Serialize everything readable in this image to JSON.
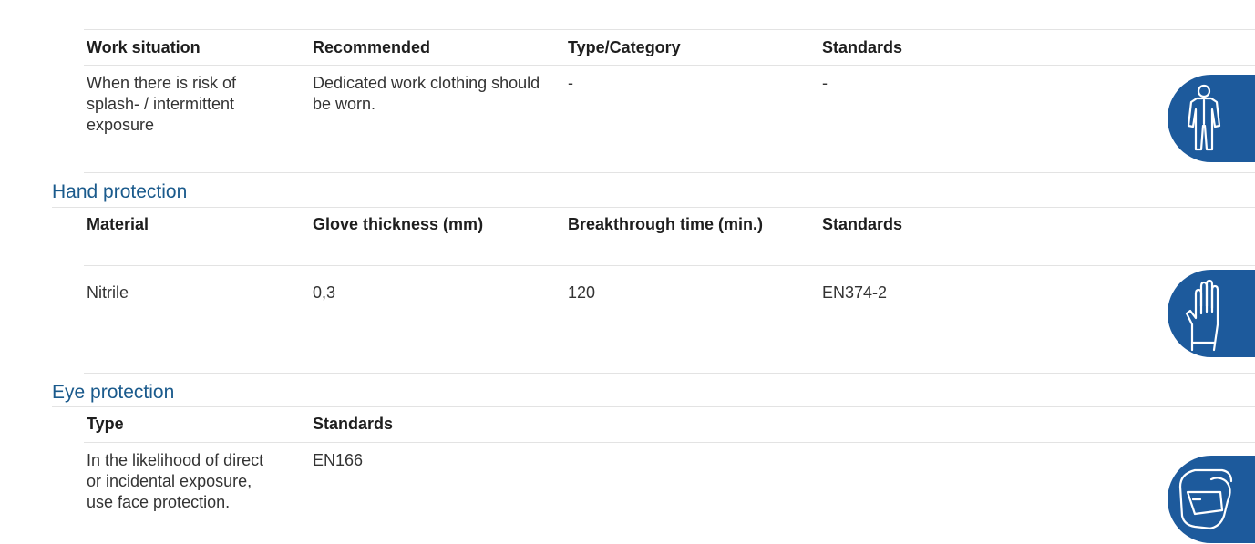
{
  "body_protection": {
    "headers": [
      "Work situation",
      "Recommended",
      "Type/Category",
      "Standards"
    ],
    "row": [
      "When there is risk of splash- / intermittent exposure",
      "Dedicated work clothing should be worn.",
      "-",
      "-"
    ],
    "icon": "protective-suit-icon"
  },
  "hand_protection": {
    "title": "Hand protection",
    "headers": [
      "Material",
      "Glove thickness (mm)",
      "Breakthrough time (min.)",
      "Standards"
    ],
    "row": [
      "Nitrile",
      "0,3",
      "120",
      "EN374-2"
    ],
    "icon": "protective-glove-icon"
  },
  "eye_protection": {
    "title": "Eye protection",
    "headers": [
      "Type",
      "Standards"
    ],
    "row": [
      "In the likelihood of direct or incidental exposure, use face protection.",
      "EN166"
    ],
    "icon": "face-shield-icon"
  },
  "colors": {
    "section_title": "#1a5a8c",
    "badge": "#1d5a9c"
  }
}
